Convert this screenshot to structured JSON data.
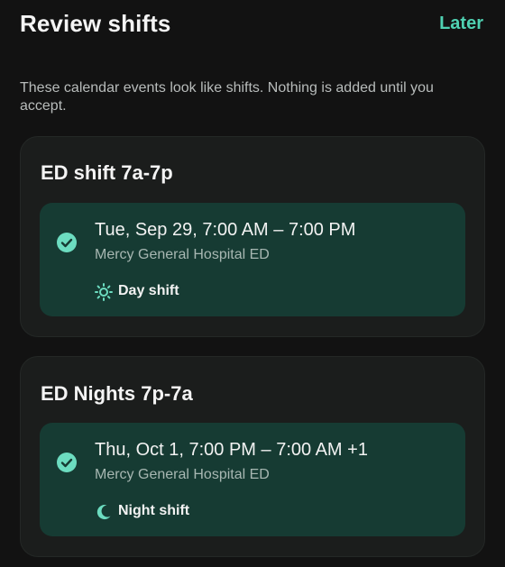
{
  "header": {
    "title": "Review shifts",
    "later_label": "Later"
  },
  "description": "These calendar events look like shifts. Nothing is added until you accept.",
  "colors": {
    "background": "#121212",
    "card": "#1b1d1c",
    "event": "#163b33",
    "accent": "#4fd1b2",
    "check": "#6cdcc0"
  },
  "cards": [
    {
      "title": "ED shift 7a-7p",
      "event": {
        "selected": true,
        "time": "Tue, Sep 29, 7:00 AM – 7:00 PM",
        "location": "Mercy General Hospital ED",
        "shift_type": "Day shift",
        "shift_icon": "sun-icon"
      }
    },
    {
      "title": "ED Nights 7p-7a",
      "event": {
        "selected": true,
        "time": "Thu, Oct 1, 7:00 PM – 7:00 AM +1",
        "location": "Mercy General Hospital ED",
        "shift_type": "Night shift",
        "shift_icon": "moon-icon"
      }
    }
  ]
}
